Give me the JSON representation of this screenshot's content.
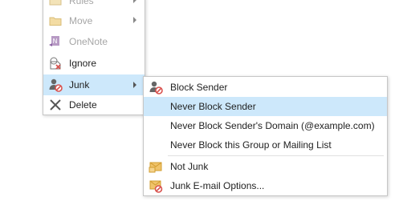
{
  "main_menu": {
    "items": [
      {
        "label": "Rules",
        "icon": "rules-icon",
        "disabled": true
      },
      {
        "label": "Move",
        "icon": "folder-move-icon",
        "disabled": true
      },
      {
        "label": "OneNote",
        "icon": "onenote-icon",
        "disabled": true
      },
      {
        "label": "Ignore",
        "icon": "ignore-icon",
        "disabled": false
      },
      {
        "label": "Junk",
        "icon": "junk-icon",
        "disabled": false
      },
      {
        "label": "Delete",
        "icon": "delete-icon",
        "disabled": false
      }
    ]
  },
  "junk_submenu": {
    "items": [
      {
        "label": "Block Sender",
        "icon": "block-sender-icon"
      },
      {
        "label": "Never Block Sender",
        "icon": ""
      },
      {
        "label": "Never Block Sender's Domain (@example.com)",
        "icon": ""
      },
      {
        "label": "Never Block this Group or Mailing List",
        "icon": ""
      },
      {
        "label": "Not Junk",
        "icon": "not-junk-icon"
      },
      {
        "label": "Junk E-mail Options...",
        "icon": "junk-options-icon"
      }
    ]
  },
  "colors": {
    "highlight": "#cde8fb",
    "disabled_text": "#a6a6a6",
    "border": "#c6c6c6"
  }
}
